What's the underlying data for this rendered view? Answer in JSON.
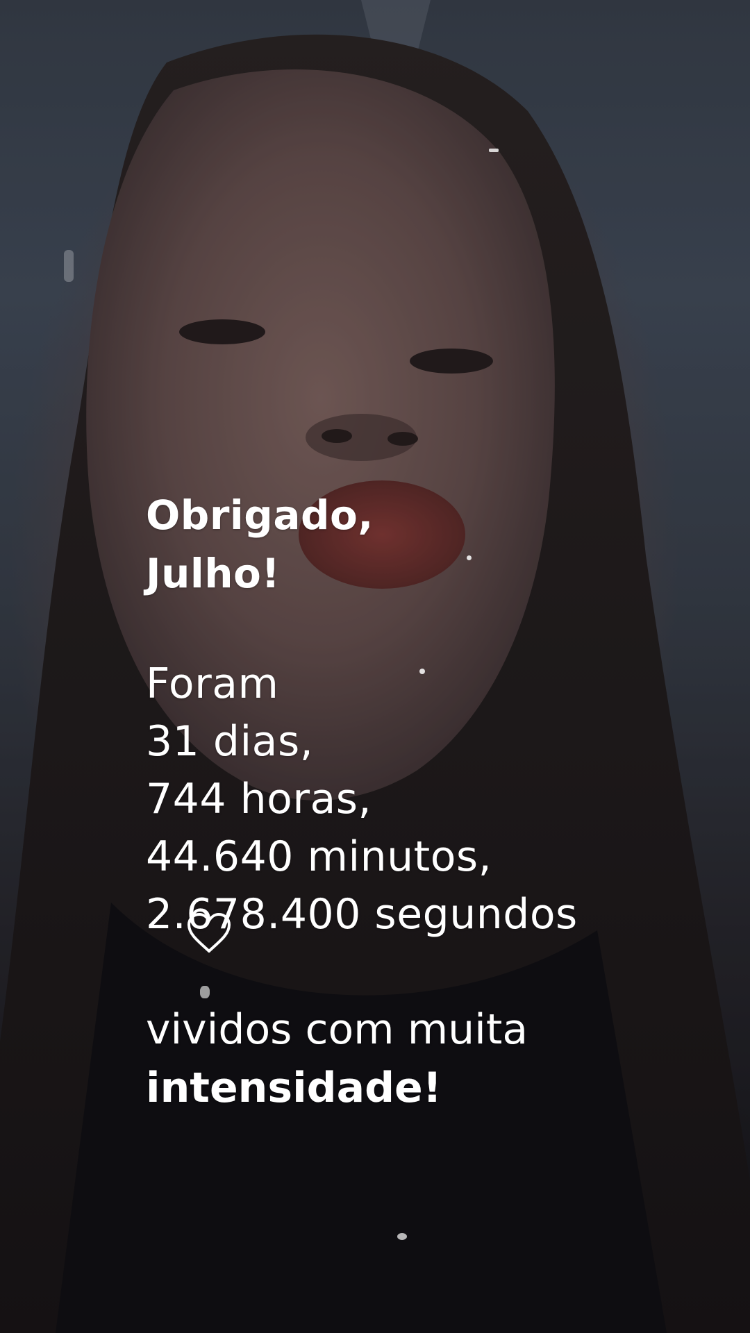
{
  "story": {
    "headline": {
      "line1": "Obrigado,",
      "line2": "Julho!"
    },
    "stats": {
      "intro": "Foram",
      "days": "31 dias,",
      "hours": "744 horas,",
      "minutes": "44.640 minutos,",
      "seconds": "2.678.400 segundos"
    },
    "closing": {
      "line1": "vividos com muita",
      "emphasis": "intensidade!"
    },
    "stickers": [
      "heart-icon",
      "sparkle"
    ]
  }
}
